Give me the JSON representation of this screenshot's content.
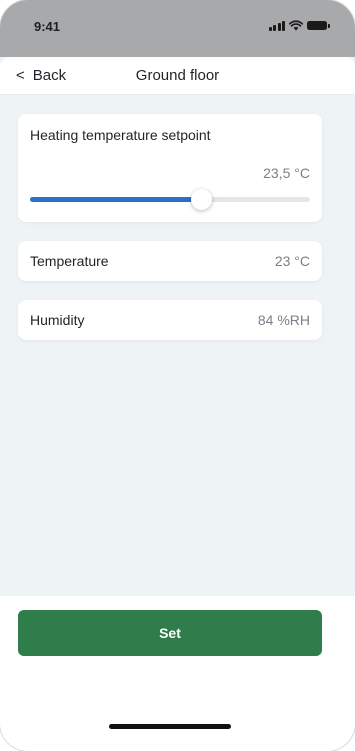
{
  "status_bar": {
    "time": "9:41",
    "icons": [
      "cellular-signal-icon",
      "wifi-icon",
      "battery-icon"
    ]
  },
  "nav": {
    "back_icon": "chevron-left-icon",
    "back_label": "Back",
    "title": "Ground floor"
  },
  "setpoint": {
    "label": "Heating temperature setpoint",
    "value": "23,5 °C",
    "slider_fraction": 0.61
  },
  "readings": [
    {
      "label": "Temperature",
      "value": "23 °C"
    },
    {
      "label": "Humidity",
      "value": "84 %RH"
    }
  ],
  "action": {
    "set_label": "Set"
  },
  "colors": {
    "accent_blue": "#2e6fc9",
    "button_green": "#2e7d4a",
    "background": "#eef3f6"
  }
}
